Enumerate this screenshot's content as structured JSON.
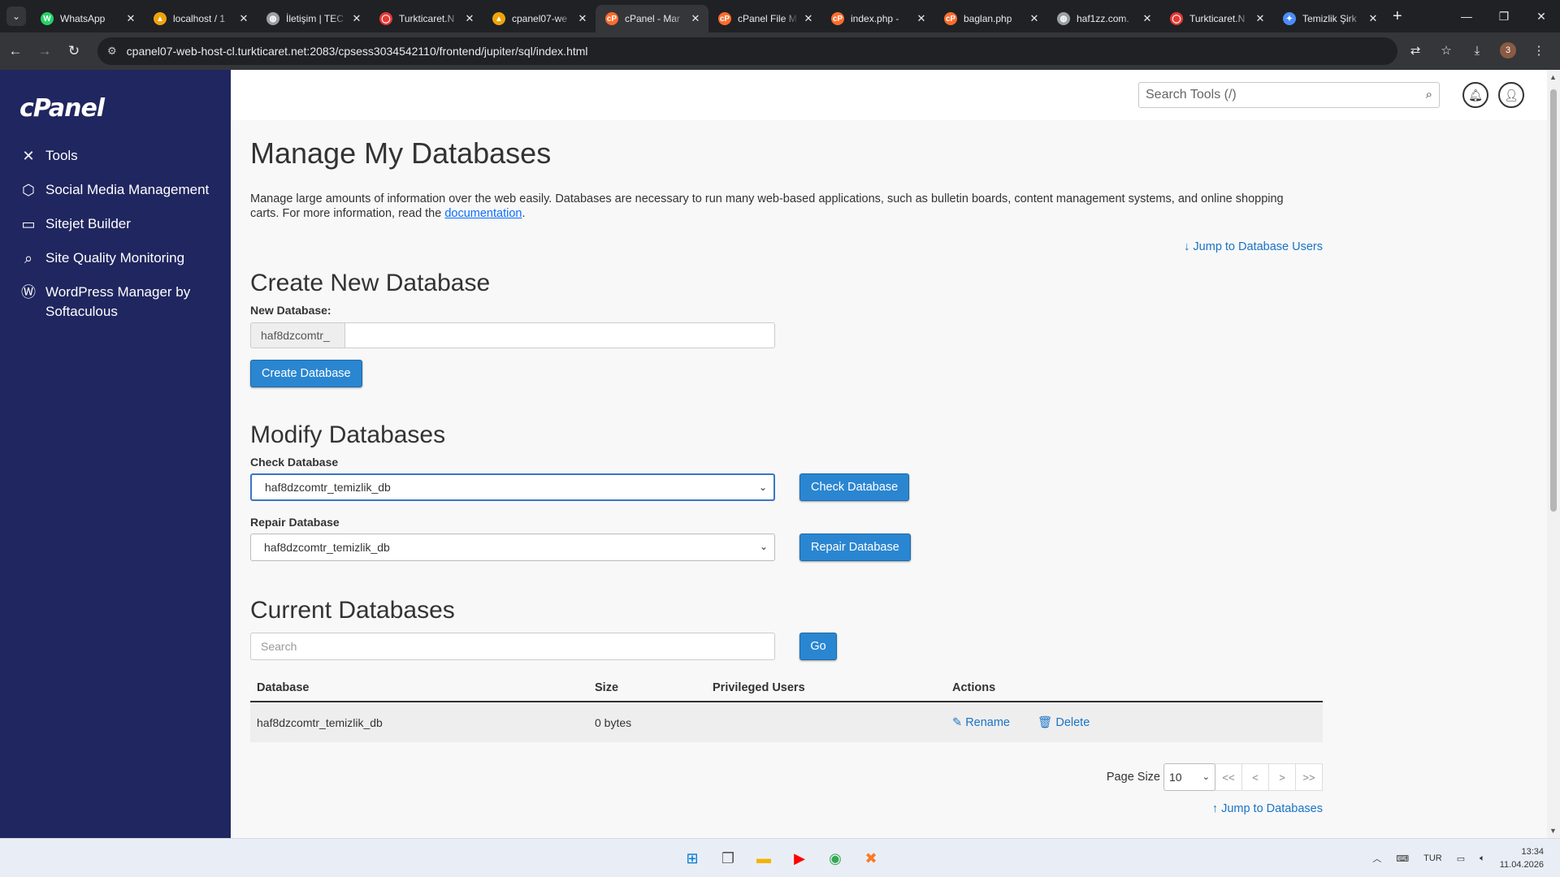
{
  "browser": {
    "tabs": [
      {
        "label": "WhatsApp",
        "favicon_color": "#25d366",
        "favicon": "W"
      },
      {
        "label": "localhost / 1",
        "favicon_color": "#f0a30a",
        "favicon": "▲"
      },
      {
        "label": "İletişim | TEC",
        "favicon_color": "#9aa0a6",
        "favicon": "◍"
      },
      {
        "label": "Turkticaret.N",
        "favicon_color": "#e53935",
        "favicon": "◯"
      },
      {
        "label": "cpanel07-we",
        "favicon_color": "#f0a30a",
        "favicon": "▲"
      },
      {
        "label": "cPanel - Mar",
        "favicon_color": "#ff6c2c",
        "favicon": "cP"
      },
      {
        "label": "cPanel File M",
        "favicon_color": "#ff6c2c",
        "favicon": "cP"
      },
      {
        "label": "index.php -",
        "favicon_color": "#ff6c2c",
        "favicon": "cP"
      },
      {
        "label": "baglan.php",
        "favicon_color": "#ff6c2c",
        "favicon": "cP"
      },
      {
        "label": "haf1zz.com.",
        "favicon_color": "#9aa0a6",
        "favicon": "◍"
      },
      {
        "label": "Turkticaret.N",
        "favicon_color": "#e53935",
        "favicon": "◯"
      },
      {
        "label": "Temizlik Şirk",
        "favicon_color": "#4c8df6",
        "favicon": "✦"
      }
    ],
    "active_tab_index": 5,
    "url": "cpanel07-web-host-cl.turkticaret.net:2083/cpsess3034542110/frontend/jupiter/sql/index.html",
    "profile_badge": "3"
  },
  "sidebar": {
    "logo": "cPanel",
    "items": [
      {
        "label": "Tools",
        "icon": "tools-icon",
        "glyph": "✕"
      },
      {
        "label": "Social Media Management",
        "icon": "social-media-icon",
        "glyph": "⬡"
      },
      {
        "label": "Sitejet Builder",
        "icon": "sitejet-icon",
        "glyph": "▭"
      },
      {
        "label": "Site Quality Monitoring",
        "icon": "site-quality-icon",
        "glyph": "⌕"
      },
      {
        "label": "WordPress Manager by Softaculous",
        "icon": "wordpress-icon",
        "glyph": "Ⓦ"
      }
    ]
  },
  "header": {
    "search_placeholder": "Search Tools (/)"
  },
  "page": {
    "title": "Manage My Databases",
    "intro_text": "Manage large amounts of information over the web easily. Databases are necessary to run many web-based applications, such as bulletin boards, content management systems, and online shopping carts. For more information, read the ",
    "intro_link": "documentation",
    "intro_end": ".",
    "jump_users": "Jump to Database Users",
    "jump_databases": "Jump to Databases"
  },
  "create": {
    "heading": "Create New Database",
    "label": "New Database:",
    "prefix": "haf8dzcomtr_",
    "value": "",
    "button": "Create Database"
  },
  "modify": {
    "heading": "Modify Databases",
    "check_label": "Check Database",
    "check_selected": "haf8dzcomtr_temizlik_db",
    "check_button": "Check Database",
    "repair_label": "Repair Database",
    "repair_selected": "haf8dzcomtr_temizlik_db",
    "repair_button": "Repair Database"
  },
  "current": {
    "heading": "Current Databases",
    "search_placeholder": "Search",
    "go_button": "Go",
    "columns": [
      "Database",
      "Size",
      "Privileged Users",
      "Actions"
    ],
    "rows": [
      {
        "database": "haf8dzcomtr_temizlik_db",
        "size": "0 bytes",
        "users": "",
        "rename": "Rename",
        "delete": "Delete"
      }
    ],
    "page_size_label": "Page Size",
    "page_size": "10",
    "pager": [
      "<<",
      "<",
      ">",
      ">>"
    ]
  },
  "taskbar": {
    "lang": "TUR",
    "time": "13:34",
    "date": "11.04.2026"
  },
  "colors": {
    "sidebar_bg": "#20265f",
    "primary_button": "#2a86d1",
    "link": "#1a73c7"
  }
}
